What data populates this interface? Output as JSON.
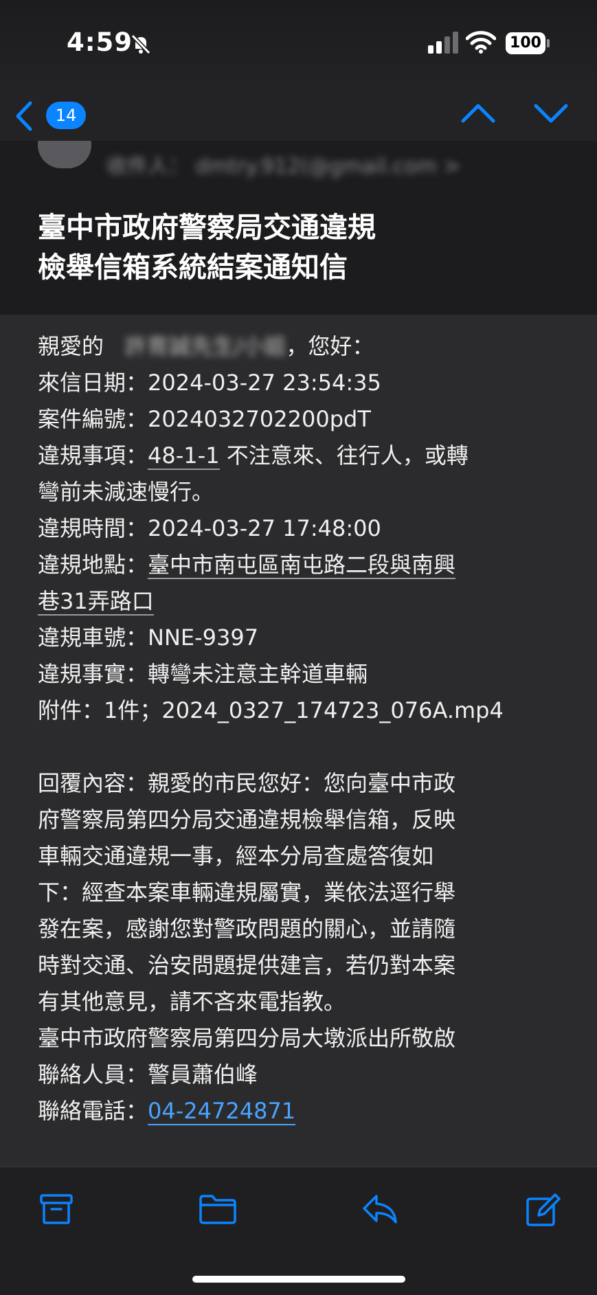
{
  "status_bar": {
    "time": "4:59",
    "battery": "100"
  },
  "nav": {
    "unread_count": "14"
  },
  "sender": {
    "label_blurred": "收件人： dmtry.912(@gmail.com >"
  },
  "subject": {
    "line1": "臺中市政府警察局交通違規",
    "line2": "檢舉信箱系統結案通知信"
  },
  "body": {
    "greeting_prefix": "親愛的",
    "greeting_name_blurred": "許育誠先生/小姐",
    "greeting_suffix": "，您好：",
    "date_label": "來信日期：",
    "date_value": "2024-03-27 23:54:35",
    "case_label": "案件編號：",
    "case_value": "2024032702200pdT",
    "item_label": "違規事項：",
    "item_code": "48-1-1",
    "item_desc_1": " 不注意來、往行人，或轉",
    "item_desc_2": "彎前未減速慢行。",
    "time_label": "違規時間：",
    "time_value": "2024-03-27 17:48:00",
    "place_label": "違規地點：",
    "place_value_1": "臺中市南屯區南屯路二段與南興",
    "place_value_2": "巷31弄路口",
    "plate_label": "違規車號：",
    "plate_value": "NNE-9397",
    "fact_label": "違規事實：",
    "fact_value": "轉彎未注意主幹道車輛",
    "attach_label": "附件：",
    "attach_value": "1件；2024_0327_174723_076A.mp4",
    "reply_lines": [
      "回覆內容：親愛的市民您好：您向臺中市政",
      "府警察局第四分局交通違規檢舉信箱，反映",
      "車輛交通違規一事，經本分局查處答復如",
      "下：經查本案車輛違規屬實，業依法逕行舉",
      "發在案，感謝您對警政問題的關心，並請隨",
      "時對交通、治安問題提供建言，若仍對本案",
      "有其他意見，請不吝來電指教。"
    ],
    "signature": "臺中市政府警察局第四分局大墩派出所敬啟",
    "contact_label": "聯絡人員：警員蕭伯峰",
    "phone_label": "聯絡電話：",
    "phone_value": "04-24724871"
  },
  "icons": {
    "accent_color": "#0a84ff",
    "names": [
      "bell-slash-icon",
      "signal-icon",
      "wifi-icon",
      "battery-icon",
      "back-chevron-icon",
      "up-chevron-icon",
      "down-chevron-icon",
      "archive-icon",
      "folder-icon",
      "reply-icon",
      "compose-icon"
    ]
  }
}
